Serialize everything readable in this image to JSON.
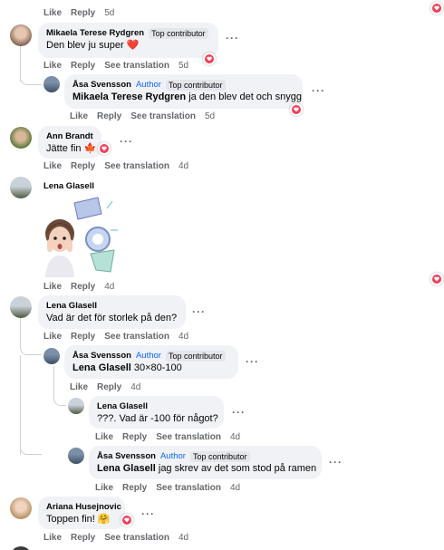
{
  "top": {
    "like": "Like",
    "reply": "Reply",
    "time": "5d"
  },
  "c1": {
    "name": "Mikaela Terese Rydgren",
    "badge": "Top contributor",
    "text": "Den blev ju super ❤️",
    "like": "Like",
    "reply": "Reply",
    "translate": "See translation",
    "time": "5d"
  },
  "r1": {
    "name": "Åsa Svensson",
    "author": "Author",
    "badge": "Top contributor",
    "mention": "Mikaela Terese Rydgren",
    "text": " ja den blev det och snygg",
    "like": "Like",
    "reply": "Reply",
    "translate": "See translation",
    "time": "5d"
  },
  "c2": {
    "name": "Ann Brandt",
    "text": "Jätte fin 🍁",
    "like": "Like",
    "reply": "Reply",
    "translate": "See translation",
    "time": "4d"
  },
  "c3": {
    "name": "Lena Glasell",
    "sticker": "WOW",
    "like": "Like",
    "reply": "Reply",
    "time": "4d"
  },
  "c4": {
    "name": "Lena Glasell",
    "text": "Vad är det för storlek på den?",
    "like": "Like",
    "reply": "Reply",
    "translate": "See translation",
    "time": "4d"
  },
  "r2": {
    "name": "Åsa Svensson",
    "author": "Author",
    "badge": "Top contributor",
    "mention": "Lena Glasell",
    "text": " 30×80-100",
    "like": "Like",
    "reply": "Reply",
    "time": "4d"
  },
  "r3": {
    "name": "Lena Glasell",
    "text": "???. Vad är -100 för något?",
    "like": "Like",
    "reply": "Reply",
    "translate": "See translation",
    "time": "4d"
  },
  "r4": {
    "name": "Åsa Svensson",
    "author": "Author",
    "badge": "Top contributor",
    "mention": "Lena Glasell",
    "text": " jag skrev av det som stod på ramen",
    "like": "Like",
    "reply": "Reply",
    "translate": "See translation",
    "time": "4d"
  },
  "c5": {
    "name": "Ariana Husejnovic",
    "text": "Toppen fin! 🤗",
    "like": "Like",
    "reply": "Reply",
    "translate": "See translation",
    "time": "4d"
  },
  "colors": {
    "heart": "#f33e58",
    "author": "#0866ff",
    "bubble": "#f0f2f5",
    "meta": "#65676b"
  }
}
